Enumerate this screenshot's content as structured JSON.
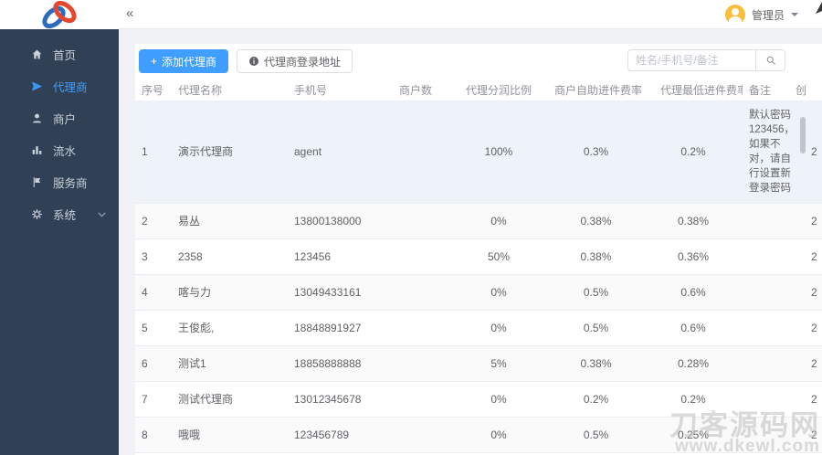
{
  "header": {
    "collapse_icon": "«",
    "user": {
      "name": "管理员"
    }
  },
  "sidebar": {
    "items": [
      {
        "label": "首页",
        "icon": "home-icon",
        "active": false
      },
      {
        "label": "代理商",
        "icon": "send-icon",
        "active": true
      },
      {
        "label": "商户",
        "icon": "user-icon",
        "active": false
      },
      {
        "label": "流水",
        "icon": "chart-icon",
        "active": false
      },
      {
        "label": "服务商",
        "icon": "flag-icon",
        "active": false
      },
      {
        "label": "系统",
        "icon": "gear-icon",
        "active": false,
        "expandable": true
      }
    ]
  },
  "toolbar": {
    "plus_icon": "+",
    "add_label": "添加代理商",
    "login_url_label": "代理商登录地址",
    "search_placeholder": "姓名/手机号/备注"
  },
  "table": {
    "columns": [
      "序号",
      "代理名称",
      "手机号",
      "商户数",
      "代理分润比例",
      "商户自助进件费率",
      "代理最低进件费率",
      "备注",
      "创"
    ],
    "rows": [
      {
        "index": "1",
        "name": "演示代理商",
        "phone": "agent",
        "merchants": "",
        "share": "100%",
        "merchant_rate": "0.3%",
        "min_rate": "0.2%",
        "remark": "默认密码123456，如果不对，请自行设置新登录密码",
        "created": "2"
      },
      {
        "index": "2",
        "name": "易丛",
        "phone": "13800138000",
        "merchants": "",
        "share": "0%",
        "merchant_rate": "0.38%",
        "min_rate": "0.38%",
        "remark": "",
        "created": "2"
      },
      {
        "index": "3",
        "name": "2358",
        "phone": "123456",
        "merchants": "",
        "share": "50%",
        "merchant_rate": "0.38%",
        "min_rate": "0.36%",
        "remark": "",
        "created": "2"
      },
      {
        "index": "4",
        "name": "喀与力",
        "phone": "13049433161",
        "merchants": "",
        "share": "0%",
        "merchant_rate": "0.5%",
        "min_rate": "0.6%",
        "remark": "",
        "created": "2"
      },
      {
        "index": "5",
        "name": "王俊彪,",
        "phone": "18848891927",
        "merchants": "",
        "share": "0%",
        "merchant_rate": "0.5%",
        "min_rate": "0.6%",
        "remark": "",
        "created": "2"
      },
      {
        "index": "6",
        "name": "测试1",
        "phone": "18858888888",
        "merchants": "",
        "share": "5%",
        "merchant_rate": "0.38%",
        "min_rate": "0.28%",
        "remark": "",
        "created": "2"
      },
      {
        "index": "7",
        "name": "测试代理商",
        "phone": "13012345678",
        "merchants": "",
        "share": "0%",
        "merchant_rate": "0.2%",
        "min_rate": "0.2%",
        "remark": "",
        "created": "2"
      },
      {
        "index": "8",
        "name": "哦哦",
        "phone": "123456789",
        "merchants": "",
        "share": "0%",
        "merchant_rate": "0.5%",
        "min_rate": "0.25%",
        "remark": "",
        "created": "2"
      }
    ]
  },
  "watermark": {
    "line1": "刀客源码网",
    "line2": "www.dkewl.com"
  },
  "colors": {
    "primary": "#409eff",
    "sidebar_bg": "#304156",
    "avatar_bg": "#fbbd3c",
    "logo_blue": "#2a6dc0",
    "logo_red": "#e5472e",
    "row_hover": "#edf3f9",
    "row_stripe": "#fafafa"
  }
}
